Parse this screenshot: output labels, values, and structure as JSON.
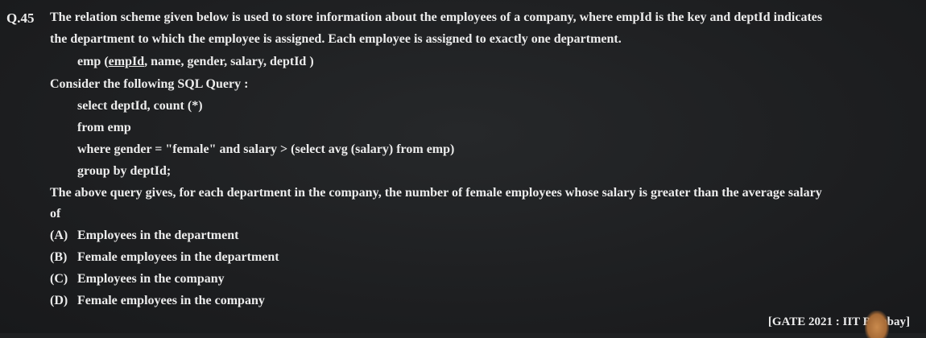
{
  "question": {
    "number": "Q.45",
    "stem_line1": "The relation scheme given below is used to store information about the employees of a company, where empId is the key and deptId indicates",
    "stem_line2": "the department to which the employee is assigned. Each employee is assigned to exactly one department.",
    "schema": {
      "prefix": "emp (",
      "key": "empId",
      "rest": ", name, gender, salary, deptId )"
    },
    "consider": "Consider the following SQL Query :",
    "sql": [
      "select deptId, count (*)",
      "from emp",
      "where gender = \"female\" and salary > (select avg (salary) from emp)",
      "group by deptId;"
    ],
    "prompt_line1": "The above query gives, for each department in the company, the number of female employees whose salary is greater than the average salary",
    "prompt_line2": "of",
    "options": [
      {
        "letter": "(A)",
        "text": "Employees in the department"
      },
      {
        "letter": "(B)",
        "text": "Female employees in the department"
      },
      {
        "letter": "(C)",
        "text": "Employees in the company"
      },
      {
        "letter": "(D)",
        "text": "Female employees in the company"
      }
    ],
    "source": "[GATE 2021 : IIT Bombay]"
  }
}
